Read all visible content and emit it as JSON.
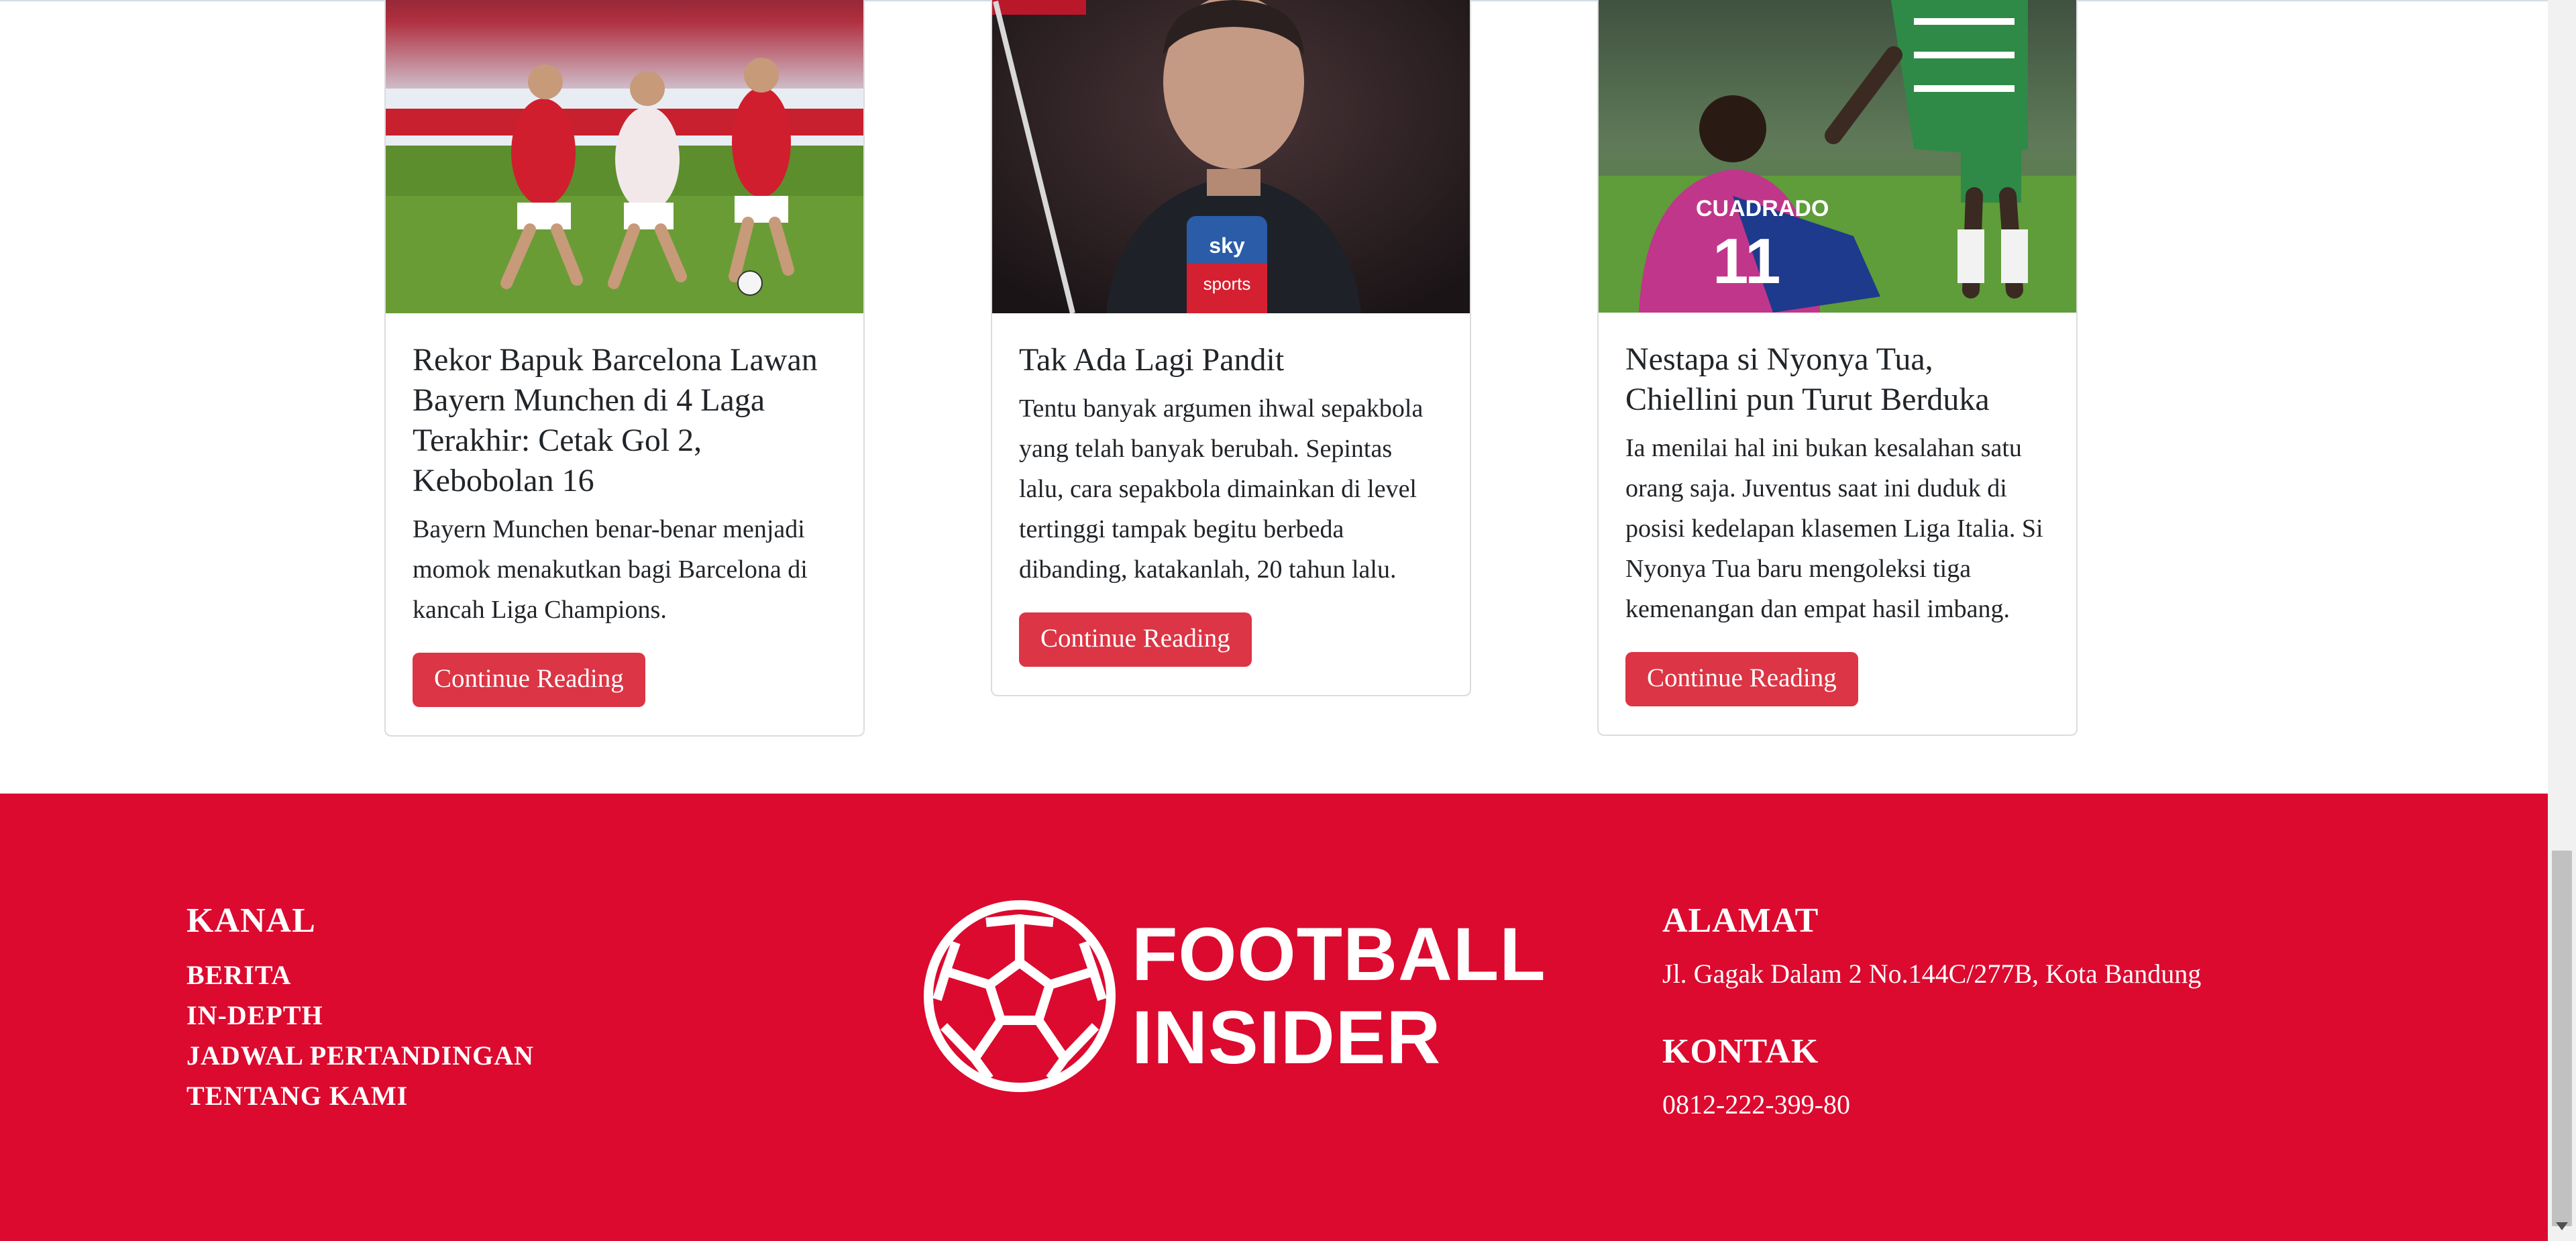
{
  "cards": [
    {
      "title": "Rekor Bapuk Barcelona Lawan Bayern Munchen di 4 Laga Terakhir: Cetak Gol 2, Kebobolan 16",
      "text": "Bayern Munchen benar-benar menjadi momok menakutkan bagi Barcelona di kancah Liga Champions.",
      "button": "Continue Reading",
      "image": "football-match-photo"
    },
    {
      "title": "Tak Ada Lagi Pandit",
      "text": "Tentu banyak argumen ihwal sepakbola yang telah banyak berubah. Sepintas lalu, cara sepakbola dimainkan di level tertinggi tampak begitu berbeda dibanding, katakanlah, 20 tahun lalu.",
      "button": "Continue Reading",
      "image": "pundit-portrait-photo"
    },
    {
      "title": "Nestapa si Nyonya Tua, Chiellini pun Turut Berduka",
      "text": "Ia menilai hal ini bukan kesalahan satu orang saja. Juventus saat ini duduk di posisi kedelapan klasemen Liga Italia. Si Nyonya Tua baru mengoleksi tiga kemenangan dan empat hasil imbang.",
      "button": "Continue Reading",
      "image": "football-match-photo"
    }
  ],
  "footer": {
    "kanal_heading": "KANAL",
    "kanal_items": [
      "BERITA",
      "IN-DEPTH",
      "JADWAL PERTANDINGAN",
      "TENTANG KAMI"
    ],
    "logo_line1": "FOOTBALL",
    "logo_line2": "INSIDER",
    "alamat_heading": "ALAMAT",
    "alamat_text": "Jl. Gagak Dalam 2 No.144C/277B, Kota Bandung",
    "kontak_heading": "KONTAK",
    "kontak_text": "0812-222-399-80"
  },
  "colors": {
    "footer_bg": "#dc0a2f",
    "button_bg": "#dc3545"
  }
}
